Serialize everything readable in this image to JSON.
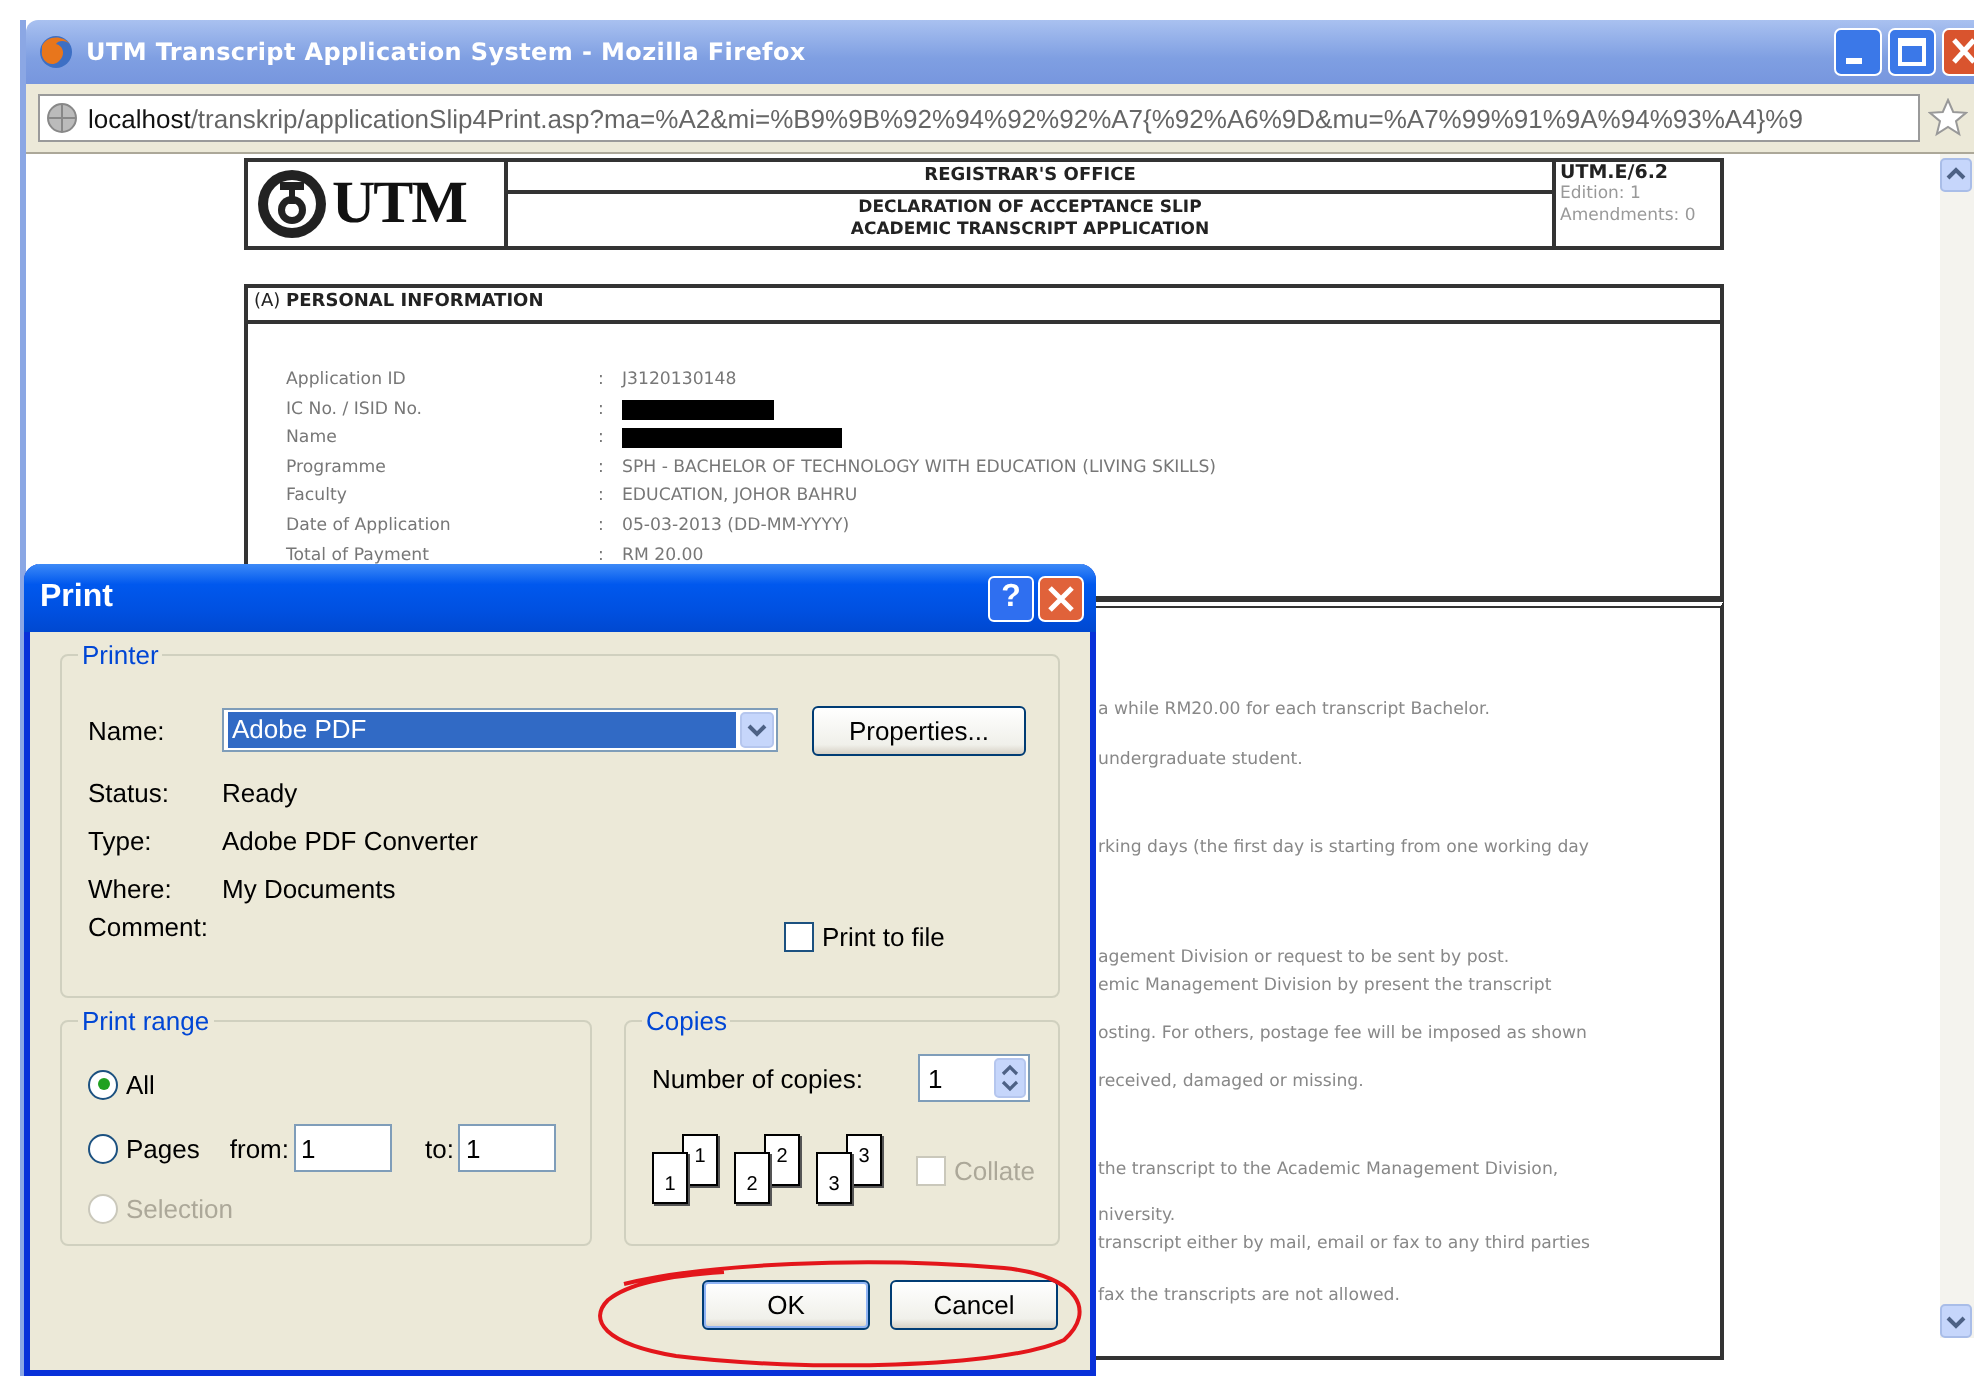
{
  "browser": {
    "title": "UTM Transcript Application System - Mozilla Firefox",
    "url": "**localhost**/transkrip/applicationSlip4Print.asp?ma=%A2&mi=%B9%9B%92%94%92%92%A7{%92%A6%9D&mu=%A7%99%91%9A%94%93%A4}%9"
  },
  "document": {
    "logo_text": "UTM",
    "office": "REGISTRAR'S OFFICE",
    "slip_title": [
      "DECLARATION OF ACCEPTANCE SLIP",
      "ACADEMIC TRANSCRIPT APPLICATION"
    ],
    "form_code": "UTM.E/6.2",
    "edition": "Edition: 1",
    "amendments": "Amendments: 0",
    "personal": {
      "heading": "(A) **PERSONAL INFORMATION**",
      "fields": [
        {
          "label": "Application ID",
          "separator": ":",
          "value": "J3120130148",
          "redacted": false
        },
        {
          "label": "IC No. / ISID No.",
          "separator": ":",
          "redacted": true
        },
        {
          "label": "Name",
          "separator": ":",
          "redacted": true
        },
        {
          "label": "Programme",
          "separator": ":",
          "value": "SPH - BACHELOR OF TECHNOLOGY WITH EDUCATION (LIVING SKILLS)",
          "redacted": false
        },
        {
          "label": "Faculty",
          "separator": ":",
          "value": "EDUCATION, JOHOR BAHRU",
          "redacted": false
        },
        {
          "label": "Date of Application",
          "separator": ":",
          "value": "05-03-2013 (DD-MM-YYYY)",
          "redacted": false
        },
        {
          "label": "Total of Payment",
          "separator": ":",
          "value": "RM 20.00",
          "redacted": false
        }
      ]
    },
    "notes": [
      "a while RM20.00 for each transcript Bachelor.",
      "undergraduate student.",
      "rking days (the first day is starting from one working day",
      "agement Division or request to be sent by post.",
      "emic Management Division by present the transcript",
      "osting. For others, postage fee will be imposed as shown",
      "received, damaged or missing.",
      "the transcript to the Academic Management Division,",
      "niversity.",
      "transcript either by mail, email or fax to any third parties",
      "fax the transcripts are not allowed."
    ]
  },
  "print_dialog": {
    "title": "Print",
    "help_button": "?",
    "printer": {
      "legend": "Printer",
      "name_label": "Name:",
      "name_value": "Adobe PDF",
      "properties_button": "Properties...",
      "info": [
        {
          "label": "Status:",
          "value": "Ready"
        },
        {
          "label": "Type:",
          "value": "Adobe PDF Converter"
        },
        {
          "label": "Where:",
          "value": "My Documents"
        }
      ],
      "comment_label": "Comment:",
      "print_to_file": {
        "label": "Print to file",
        "checked": false
      }
    },
    "print_range": {
      "legend": "Print range",
      "options": [
        {
          "label": "All",
          "selected": true,
          "disabled": false
        },
        {
          "label": "Pages",
          "selected": false,
          "disabled": false
        },
        {
          "label": "Selection",
          "selected": false,
          "disabled": true
        }
      ],
      "from_label": "from:",
      "from_value": "1",
      "to_label": "to:",
      "to_value": "1"
    },
    "copies": {
      "legend": "Copies",
      "label": "Number of copies:",
      "value": "1",
      "collate_sets": [
        {
          "front": "1",
          "back": "1"
        },
        {
          "front": "2",
          "back": "2"
        },
        {
          "front": "3",
          "back": "3"
        }
      ],
      "collate": {
        "label": "Collate",
        "checked": false,
        "disabled": true
      }
    },
    "buttons": [
      {
        "label": "OK",
        "default": true
      },
      {
        "label": "Cancel",
        "default": false
      }
    ]
  }
}
